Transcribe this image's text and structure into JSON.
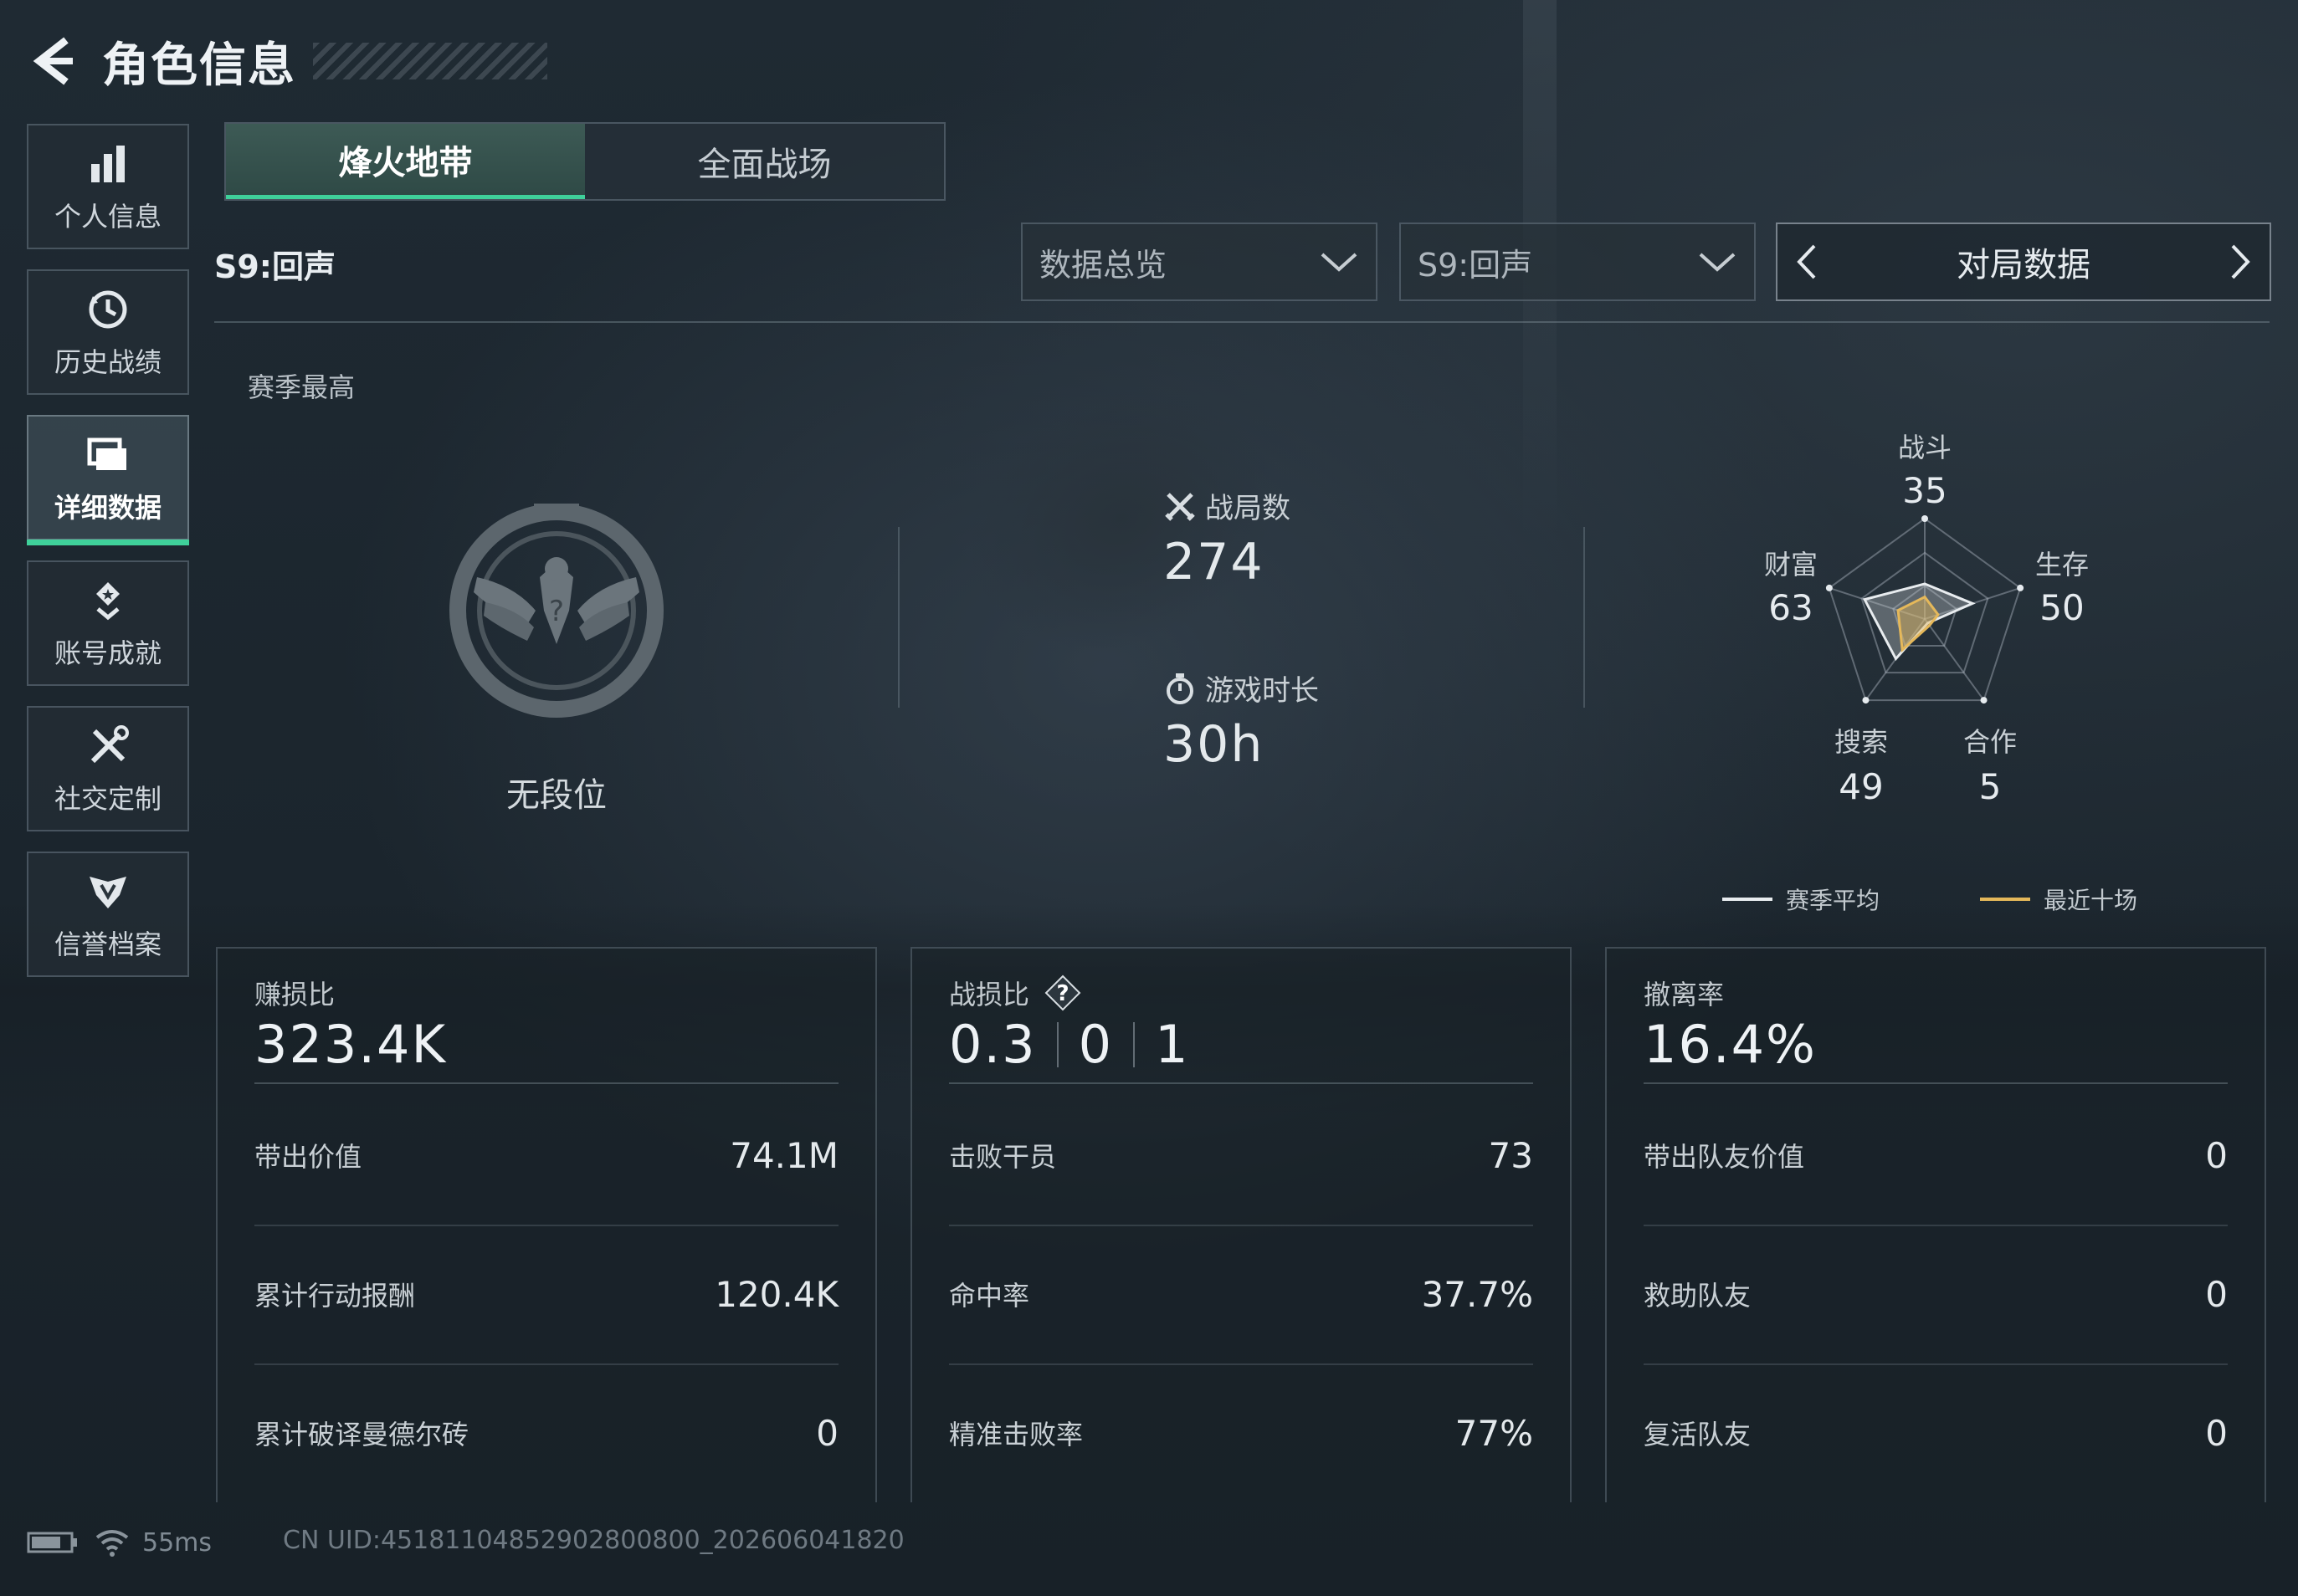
{
  "header": {
    "title": "角色信息"
  },
  "side_nav": [
    {
      "label": "个人信息",
      "icon": "bar-chart-icon"
    },
    {
      "label": "历史战绩",
      "icon": "history-clock-icon"
    },
    {
      "label": "详细数据",
      "icon": "data-cards-icon",
      "active": true
    },
    {
      "label": "账号成就",
      "icon": "medal-icon"
    },
    {
      "label": "社交定制",
      "icon": "tools-icon"
    },
    {
      "label": "信誉档案",
      "icon": "shield-wing-icon"
    }
  ],
  "mode_tabs": [
    {
      "label": "烽火地带",
      "active": true
    },
    {
      "label": "全面战场",
      "active": false
    }
  ],
  "season_label": "S9:回声",
  "filters": {
    "category": "数据总览",
    "season": "S9:回声",
    "view": "对局数据"
  },
  "season_best": {
    "label": "赛季最高",
    "rank": "无段位"
  },
  "match_stats": {
    "matches_label": "战局数",
    "matches_value": "274",
    "playtime_label": "游戏时长",
    "playtime_value": "30h"
  },
  "radar": {
    "axes": [
      {
        "label": "战斗",
        "value": "35"
      },
      {
        "label": "生存",
        "value": "50"
      },
      {
        "label": "合作",
        "value": "5"
      },
      {
        "label": "搜索",
        "value": "49"
      },
      {
        "label": "财富",
        "value": "63"
      }
    ],
    "legend": [
      {
        "label": "赛季平均",
        "color": "#e8ecef"
      },
      {
        "label": "最近十场",
        "color": "#e5b85a"
      }
    ],
    "series_season_avg": [
      35,
      50,
      5,
      49,
      63
    ],
    "series_recent10": [
      22,
      14,
      8,
      38,
      28
    ]
  },
  "cards": [
    {
      "title": "赚损比",
      "big": "323.4K",
      "rows": [
        {
          "label": "带出价值",
          "value": "74.1M"
        },
        {
          "label": "累计行动报酬",
          "value": "120.4K"
        },
        {
          "label": "累计破译曼德尔砖",
          "value": "0"
        }
      ]
    },
    {
      "title": "战损比",
      "big_parts": [
        "0.3",
        "0",
        "1"
      ],
      "rows": [
        {
          "label": "击败干员",
          "value": "73"
        },
        {
          "label": "命中率",
          "value": "37.7%"
        },
        {
          "label": "精准击败率",
          "value": "77%"
        }
      ]
    },
    {
      "title": "撤离率",
      "big": "16.4%",
      "rows": [
        {
          "label": "带出队友价值",
          "value": "0"
        },
        {
          "label": "救助队友",
          "value": "0"
        },
        {
          "label": "复活队友",
          "value": "0"
        }
      ]
    }
  ],
  "footer": {
    "ping": "55ms",
    "uid": "CN UID:451811048529028008​00_202606041820"
  },
  "colors": {
    "accent": "#3fd09a",
    "recent": "#e5b85a"
  }
}
